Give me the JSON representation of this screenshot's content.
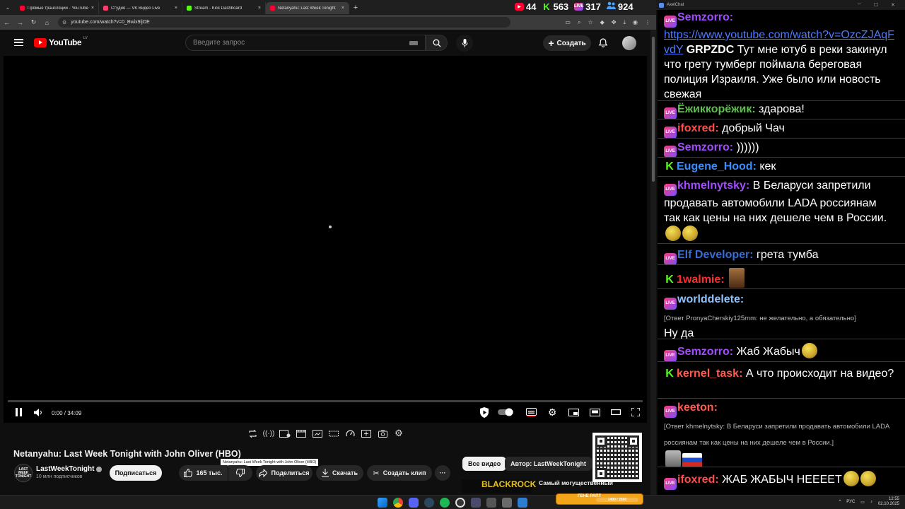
{
  "browser": {
    "tabs": [
      {
        "title": "Прямые трансляции - YouTube",
        "color": "#ff0033"
      },
      {
        "title": "Студия — VK Видео Live",
        "color": "#ff3d6e"
      },
      {
        "title": "Stream - Kick Dashboard",
        "color": "#53fc18"
      },
      {
        "title": "Netanyahu: Last Week Tonight",
        "color": "#ff0033",
        "active": true
      }
    ],
    "url": "youtube.com/watch?v=0_Bwix9ljOE",
    "close_glyph": "×",
    "new_tab_glyph": "+"
  },
  "viewer_counts": [
    {
      "platform": "youtube",
      "icon": "youtube-icon",
      "value": "44",
      "color": "#ff0033"
    },
    {
      "platform": "kick",
      "icon": "kick-icon",
      "value": "563",
      "color": "#53fc18"
    },
    {
      "platform": "vk",
      "icon": "vk-live-icon",
      "value": "317",
      "color": "#ff3d6e"
    },
    {
      "platform": "total",
      "icon": "people-icon",
      "value": "924",
      "color": "#4fa3ff"
    }
  ],
  "youtube": {
    "logo_text": "YouTube",
    "region": "LV",
    "search_placeholder": "Введите запрос",
    "create_label": "Создать",
    "player": {
      "time_current": "0:00",
      "time_total": "34:09",
      "progress_fraction": 0
    },
    "video_title": "Netanyahu: Last Week Tonight with John Oliver (HBO)",
    "tooltip_text": "Netanyahu: Last Week Tonight with John Oliver (HBO)",
    "channel": {
      "name": "LastWeekTonight",
      "subscribers": "10 млн подписчиков",
      "avatar_text": "LAST WEEK TONIGHT"
    },
    "subscribe_label": "Подписаться",
    "likes": "165 тыс.",
    "share_label": "Поделиться",
    "download_label": "Скачать",
    "clip_label": "Создать клип",
    "more_glyph": "···",
    "chips": [
      "Все видео",
      "Автор: LastWeekTonight"
    ],
    "recommended": {
      "thumb_text": "BLACKROCK",
      "title": "Самый могущественный"
    }
  },
  "chat_window": {
    "title": "AxelChat",
    "messages": [
      {
        "platform": "vk",
        "user": "Semzorro:",
        "color": "#a24cff",
        "link": "https://www.youtube.com/watch?v=OzcZJAqFvdY",
        "text_bold": "GRPZDC",
        "text": "Тут мне ютуб в реки закинул что грету тумберг поймала береговая полиция Израиля. Уже было или новость свежая"
      },
      {
        "platform": "vk",
        "user": "Ёжиккорёжик:",
        "color": "#5fbf4f",
        "text": "здарова!"
      },
      {
        "platform": "vk",
        "user": "ifoxred:",
        "color": "#ff4d4d",
        "text": "добрый Чач"
      },
      {
        "platform": "vk",
        "user": "Semzorro:",
        "color": "#a24cff",
        "text": "))))))"
      },
      {
        "platform": "kick",
        "user": "Eugene_Hood:",
        "color": "#3a8dff",
        "text": "кек"
      },
      {
        "platform": "vk",
        "user": "khmelnytsky:",
        "color": "#a24cff",
        "text": "В Беларуси запретили продавать автомобили LADA россиянам так как цены на них дешеле чем в России."
      },
      {
        "platform": "vk",
        "user": "Elf Developer:",
        "color": "#3a6dd1",
        "text": "грета тумба"
      },
      {
        "platform": "kick",
        "user": "1walmie:",
        "color": "#ff2d2d",
        "text": ""
      },
      {
        "platform": "vk",
        "user": "worlddelete:",
        "color": "#8fc3ff",
        "reply": "[Ответ PronyaCherskiy125mm: не желательно, а обязательно]",
        "text": "Ну да"
      },
      {
        "platform": "vk",
        "user": "Semzorro:",
        "color": "#a24cff",
        "text": "Жаб Жабыч"
      },
      {
        "platform": "kick",
        "user": "kernel_task:",
        "color": "#ff5a4d",
        "text": "А что происходит на видео?"
      },
      {
        "platform": "vk",
        "user": "keeton:",
        "color": "#ff5a4d",
        "reply": "[Ответ khmelnytsky: В Беларуси запретили продавать автомобили LADA россиянам так как цены на них дешеле чем в России.]",
        "text": ""
      },
      {
        "platform": "vk",
        "user": "ifoxred:",
        "color": "#ff4d4d",
        "text": "ЖАБ ЖАБЫЧ НЕЕЕЕТ"
      }
    ],
    "badge_live": "LIVE",
    "badge_kick": "K"
  },
  "taskbar": {
    "lang": "РУС",
    "time": "12:55",
    "date": "02.10.2025",
    "overlay_text": "ГЕНЕ РАПТ",
    "overlay_progress": "1400 / 2500"
  }
}
